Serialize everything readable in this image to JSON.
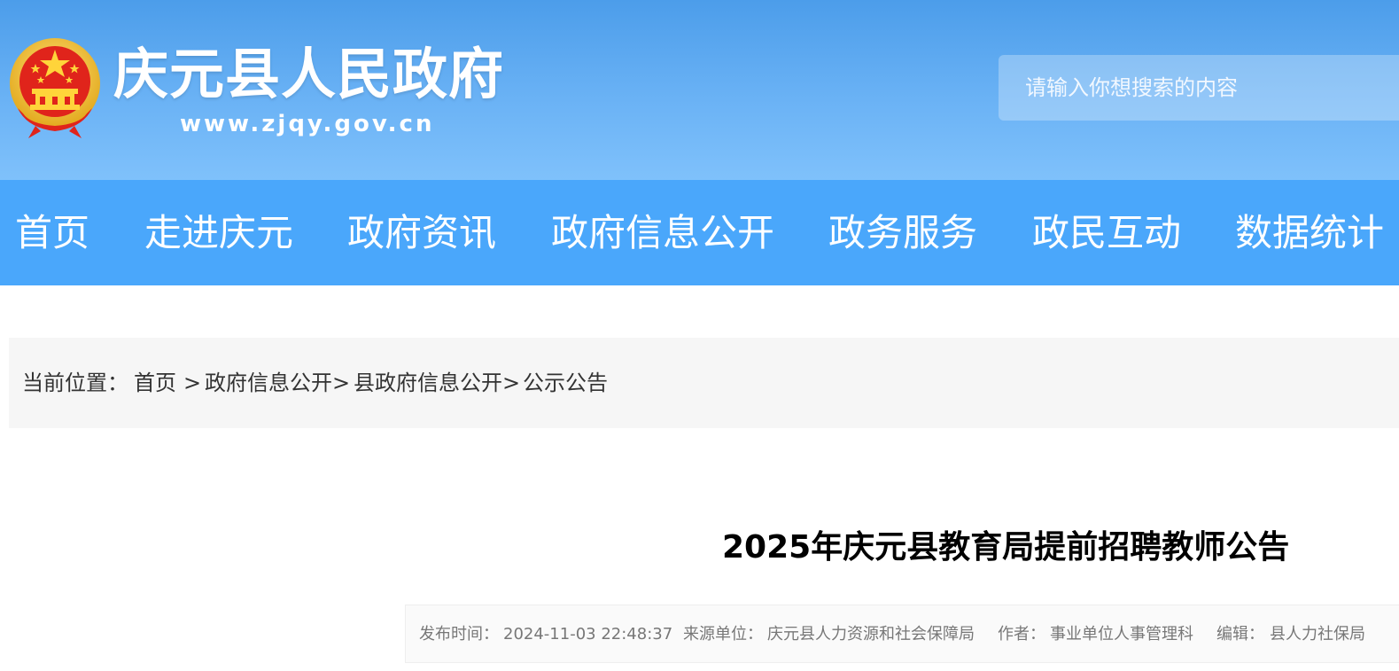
{
  "header": {
    "title": "庆元县人民政府",
    "url": "www.zjqy.gov.cn",
    "emblem_icon": "national-emblem-icon",
    "search_placeholder": "请输入你想搜索的内容"
  },
  "nav": {
    "items": [
      {
        "label": "首页"
      },
      {
        "label": "走进庆元"
      },
      {
        "label": "政府资讯"
      },
      {
        "label": "政府信息公开"
      },
      {
        "label": "政务服务"
      },
      {
        "label": "政民互动"
      },
      {
        "label": "数据统计"
      }
    ]
  },
  "breadcrumb": {
    "prefix": "当前位置：",
    "items": [
      "首页",
      "政府信息公开",
      "县政府信息公开",
      "公示公告"
    ],
    "separators": [
      ">",
      ">",
      ">"
    ]
  },
  "article": {
    "title": "2025年庆元县教育局提前招聘教师公告",
    "meta": {
      "publish_label": "发布时间：",
      "publish_value": "2024-11-03 22:48:37",
      "source_label": "来源单位：",
      "source_value": "庆元县人力资源和社会保障局",
      "author_label": "作者：",
      "author_value": "事业单位人事管理科",
      "editor_label": "编辑：",
      "editor_value": "县人力社保局"
    }
  },
  "colors": {
    "header_top": "#4c9dea",
    "header_bottom": "#7fc1fb",
    "nav_bg": "#4aa7fb",
    "breadcrumb_bg": "#f6f6f6"
  }
}
